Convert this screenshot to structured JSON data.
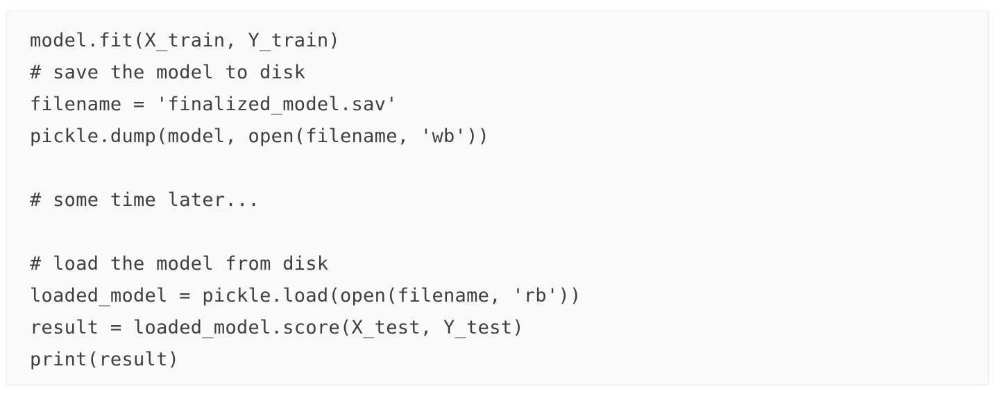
{
  "code": {
    "lines": [
      "model.fit(X_train, Y_train)",
      "# save the model to disk",
      "filename = 'finalized_model.sav'",
      "pickle.dump(model, open(filename, 'wb'))",
      "",
      "# some time later...",
      "",
      "# load the model from disk",
      "loaded_model = pickle.load(open(filename, 'rb'))",
      "result = loaded_model.score(X_test, Y_test)",
      "print(result)"
    ]
  },
  "colors": {
    "background": "#ffffff",
    "code_background": "#f9f9f9",
    "code_border": "#ececec",
    "code_text": "#3f3f3f"
  }
}
